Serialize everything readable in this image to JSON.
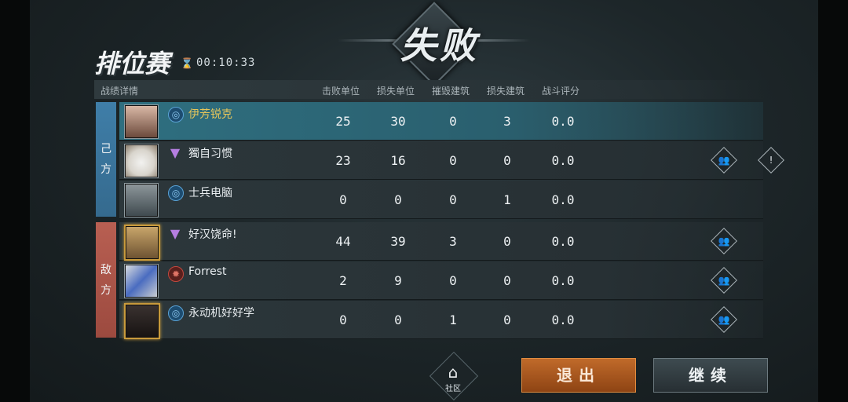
{
  "header": {
    "result": "失败",
    "mode": "排位赛",
    "timer": "00:10:33"
  },
  "columns": [
    "战绩详情",
    "击败单位",
    "损失单位",
    "摧毁建筑",
    "损失建筑",
    "战斗评分"
  ],
  "teams": {
    "own": [
      "己",
      "方"
    ],
    "enemy": [
      "敌",
      "方"
    ]
  },
  "players": [
    {
      "name": "伊芳锐克",
      "rank": "blue",
      "stats": [
        "25",
        "30",
        "0",
        "3",
        "0.0"
      ],
      "me": true
    },
    {
      "name": "獨自习惯",
      "rank": "purple",
      "stats": [
        "23",
        "16",
        "0",
        "0",
        "0.0"
      ]
    },
    {
      "name": "士兵电脑",
      "rank": "blue",
      "stats": [
        "0",
        "0",
        "0",
        "1",
        "0.0"
      ]
    },
    {
      "name": "好汉饶命!",
      "rank": "purple",
      "stats": [
        "44",
        "39",
        "3",
        "0",
        "0.0"
      ]
    },
    {
      "name": "Forrest",
      "rank": "red",
      "stats": [
        "2",
        "9",
        "0",
        "0",
        "0.0"
      ]
    },
    {
      "name": "永动机好好学",
      "rank": "blue",
      "stats": [
        "0",
        "0",
        "1",
        "0",
        "0.0"
      ]
    }
  ],
  "icons": {
    "add_friend": "add-friend-icon",
    "report": "report-icon",
    "home": "home-icon",
    "hourglass": "hourglass-icon"
  },
  "footer": {
    "community": "社区",
    "exit": "退出",
    "continue": "继续"
  },
  "colors": {
    "own_team": "#3f7ea8",
    "enemy_team": "#b85f52",
    "highlight_name": "#e8c65a",
    "exit_button": "#c06a2a"
  }
}
